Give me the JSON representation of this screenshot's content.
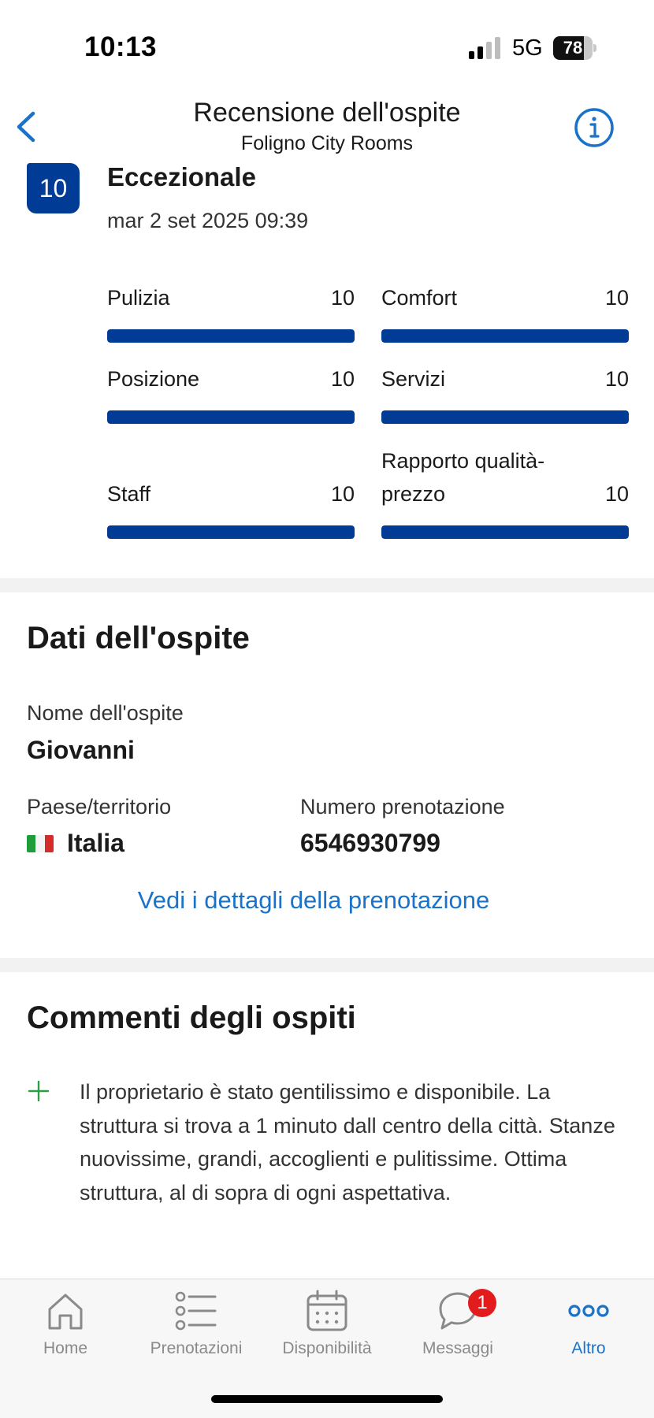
{
  "status_bar": {
    "time": "10:13",
    "network": "5G",
    "battery": "78",
    "battery_level": 0.78
  },
  "header": {
    "title": "Recensione dell'ospite",
    "subtitle": "Foligno City Rooms",
    "back_icon": "chevron-left-icon",
    "info_icon": "info-icon"
  },
  "review": {
    "score": "10",
    "rating_word": "Eccezionale",
    "date": "mar 2 set 2025 09:39",
    "categories": [
      {
        "label": "Pulizia",
        "score": "10",
        "value": 10,
        "max": 10
      },
      {
        "label": "Comfort",
        "score": "10",
        "value": 10,
        "max": 10
      },
      {
        "label": "Posizione",
        "score": "10",
        "value": 10,
        "max": 10
      },
      {
        "label": "Servizi",
        "score": "10",
        "value": 10,
        "max": 10
      },
      {
        "label": "Staff",
        "score": "10",
        "value": 10,
        "max": 10
      },
      {
        "label": "Rapporto qualità-prezzo",
        "score": "10",
        "value": 10,
        "max": 10
      }
    ]
  },
  "guest": {
    "section_title": "Dati dell'ospite",
    "name_label": "Nome dell'ospite",
    "name": "Giovanni",
    "country_label": "Paese/territorio",
    "country": "Italia",
    "booking_label": "Numero prenotazione",
    "booking_number": "6546930799",
    "details_link": "Vedi i dettagli della prenotazione"
  },
  "comments": {
    "section_title": "Commenti degli ospiti",
    "positive_icon": "plus-icon",
    "positive": "Il proprietario è stato gentilissimo e disponibile. La struttura si trova a 1 minuto dall centro della città. Stanze nuovissime, grandi, accoglienti e pulitissime. Ottima struttura, al di sopra di ogni aspettativa."
  },
  "tab_bar": {
    "tabs": [
      {
        "label": "Home",
        "icon": "home-icon"
      },
      {
        "label": "Prenotazioni",
        "icon": "list-icon"
      },
      {
        "label": "Disponibilità",
        "icon": "calendar-icon"
      },
      {
        "label": "Messaggi",
        "icon": "chat-icon",
        "badge": "1"
      },
      {
        "label": "Altro",
        "icon": "more-icon",
        "active": true
      }
    ]
  },
  "colors": {
    "brand_blue": "#003b95",
    "link_blue": "#1a73c8",
    "badge_red": "#e21c1c",
    "positive_green": "#2e9e44"
  }
}
